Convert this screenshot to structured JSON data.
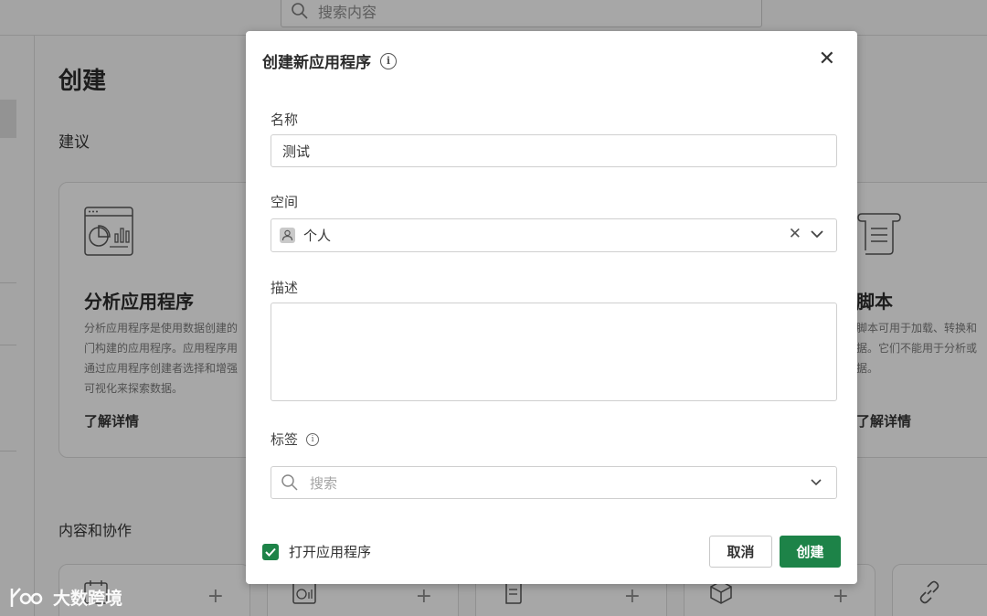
{
  "background": {
    "search_placeholder": "搜索内容",
    "page_title": "创建",
    "section_suggest": "建议",
    "section_content": "内容和协作",
    "card_analytics": {
      "title": "分析应用程序",
      "desc": "分析应用程序是使用数据创建的门构建的应用程序。应用程序用通过应用程序创建者选择和增强可视化来探索数据。",
      "more": "了解详情"
    },
    "card_script": {
      "title": "脚本",
      "desc": "脚本可用于加载、转换和据。它们不能用于分析或据。",
      "more": "了解详情"
    }
  },
  "dialog": {
    "title": "创建新应用程序",
    "name_label": "名称",
    "name_value": "测试",
    "space_label": "空间",
    "space_value": "个人",
    "description_label": "描述",
    "description_value": "",
    "tags_label": "标签",
    "tags_placeholder": "搜索",
    "open_app_label": "打开应用程序",
    "open_app_checked": true,
    "cancel_label": "取消",
    "create_label": "创建"
  },
  "watermark": {
    "text": "大数跨境"
  },
  "colors": {
    "accent": "#1d8348",
    "overlay": "rgba(0,0,0,0.32)"
  }
}
